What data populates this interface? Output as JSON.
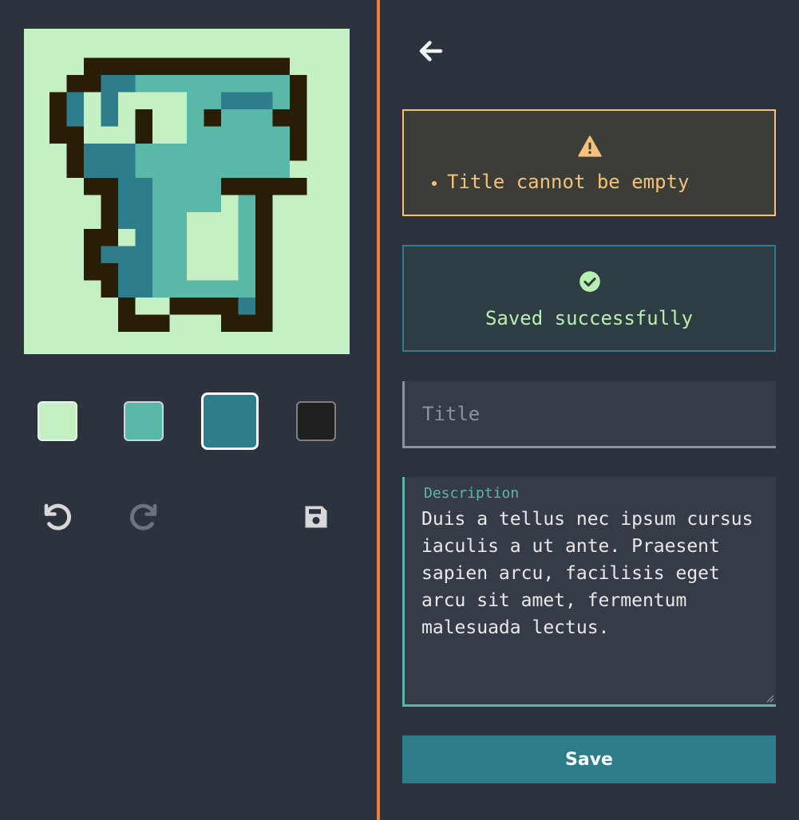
{
  "editor": {
    "canvas_background": "#c5f0c4",
    "palette": [
      {
        "name": "light-green",
        "color": "#c5f0c4",
        "selected": false
      },
      {
        "name": "teal",
        "color": "#5ab8a8",
        "selected": false
      },
      {
        "name": "dark-teal",
        "color": "#2e7d8c",
        "selected": true
      },
      {
        "name": "black",
        "color": "#202020",
        "selected": false
      }
    ],
    "tools": {
      "undo_icon": "undo-icon",
      "redo_icon": "redo-icon",
      "save_icon": "floppy-disk-icon",
      "redo_enabled": false
    }
  },
  "colors": {
    "accent_divider": "#f08030",
    "warning": "#f5c07a",
    "success": "#b8f0b0",
    "primary": "#2e7d8c",
    "field_accent": "#5ab8a8"
  },
  "form": {
    "back_icon": "arrow-left-icon",
    "warning": {
      "icon": "warning-triangle-icon",
      "errors": [
        "Title cannot be empty"
      ]
    },
    "success": {
      "icon": "check-circle-icon",
      "message": "Saved successfully"
    },
    "title": {
      "placeholder": "Title",
      "value": ""
    },
    "description": {
      "label": "Description",
      "value": "Duis a tellus nec ipsum cursus iaculis a ut ante. Praesent sapien arcu, facilisis eget arcu sit amet, fermentum malesuada lectus."
    },
    "save_label": "Save"
  }
}
